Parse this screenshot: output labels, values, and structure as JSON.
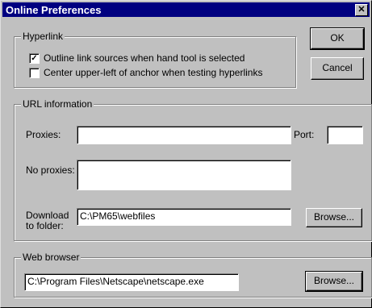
{
  "window": {
    "title": "Online Preferences",
    "close_glyph": "✕"
  },
  "hyperlink": {
    "label": "Hyperlink",
    "options": [
      {
        "label": "Outline link sources when hand tool is selected",
        "checked": true
      },
      {
        "label": "Center upper-left of anchor when testing hyperlinks",
        "checked": false
      }
    ]
  },
  "url_info": {
    "label": "URL information",
    "proxies_label": "Proxies:",
    "proxies_value": "",
    "port_label": "Port:",
    "port_value": "",
    "no_proxies_label": "No proxies:",
    "no_proxies_value": "",
    "download_label_line1": "Download",
    "download_label_line2": "to folder:",
    "download_value": "C:\\PM65\\webfiles",
    "browse_label": "Browse..."
  },
  "web_browser": {
    "label": "Web browser",
    "path": "C:\\Program Files\\Netscape\\netscape.exe",
    "browse_label": "Browse..."
  },
  "buttons": {
    "ok": "OK",
    "cancel": "Cancel"
  },
  "check_glyph": "✓"
}
